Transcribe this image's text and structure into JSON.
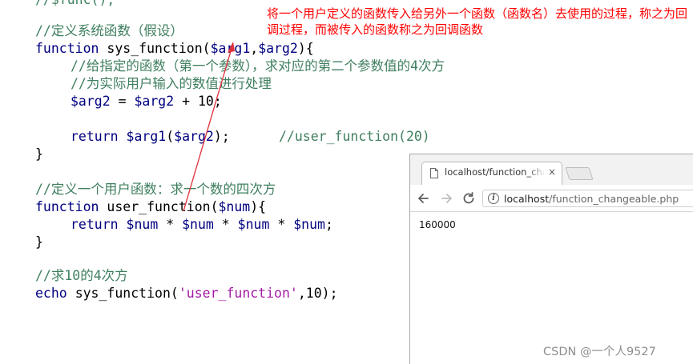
{
  "code": {
    "top_fragment": "//$func();",
    "comment_define_system": "//定义系统函数（假设）",
    "kw_function": "function",
    "sys_function_name": "sys_function",
    "paren_open": "(",
    "var_arg1": "$arg1",
    "comma": ",",
    "var_arg2": "$arg2",
    "brace_open_tail": "){",
    "comment_apply": "//给指定的函数（第一个参数），求对应的第二个参数值的4次方",
    "comment_process": "//为实际用户输入的数值进行处理",
    "assign_op": " = ",
    "plus_op": " + ",
    "num_10": "10",
    "semicolon": ";",
    "kw_return": "return",
    "call_close": ");",
    "comment_user_call": "//user_function(20)",
    "close_brace": "}",
    "comment_define_user": "//定义一个用户函数：求一个数的四次方",
    "user_function_name": "user_function",
    "var_num": "$num",
    "mul_op": " * ",
    "comment_pow": "//求10的4次方",
    "kw_echo": "echo",
    "string_user_function": "'user_function'",
    "arg_10": "10"
  },
  "annotation": {
    "text": "将一个用户定义的函数传入给另外一个函数（函数名）去使用的过程，称之为回调过程，而被传入的函数称之为回调函数",
    "color": "#ff0000"
  },
  "browser": {
    "tab_title": "localhost/function_changeable.php",
    "tab_close": "×",
    "url_host": "localhost",
    "url_path": "/function_changeable.php",
    "info_glyph": "i",
    "output": "160000"
  },
  "watermark": "CSDN @一个人9527",
  "colors": {
    "comment": "#3f7f5f",
    "keyword": "#000080",
    "string": "#a31ba3",
    "annotation": "#ff0000"
  },
  "icons": [
    "page-icon",
    "close-icon",
    "new-tab-icon",
    "back-icon",
    "forward-icon",
    "reload-icon",
    "info-icon"
  ]
}
